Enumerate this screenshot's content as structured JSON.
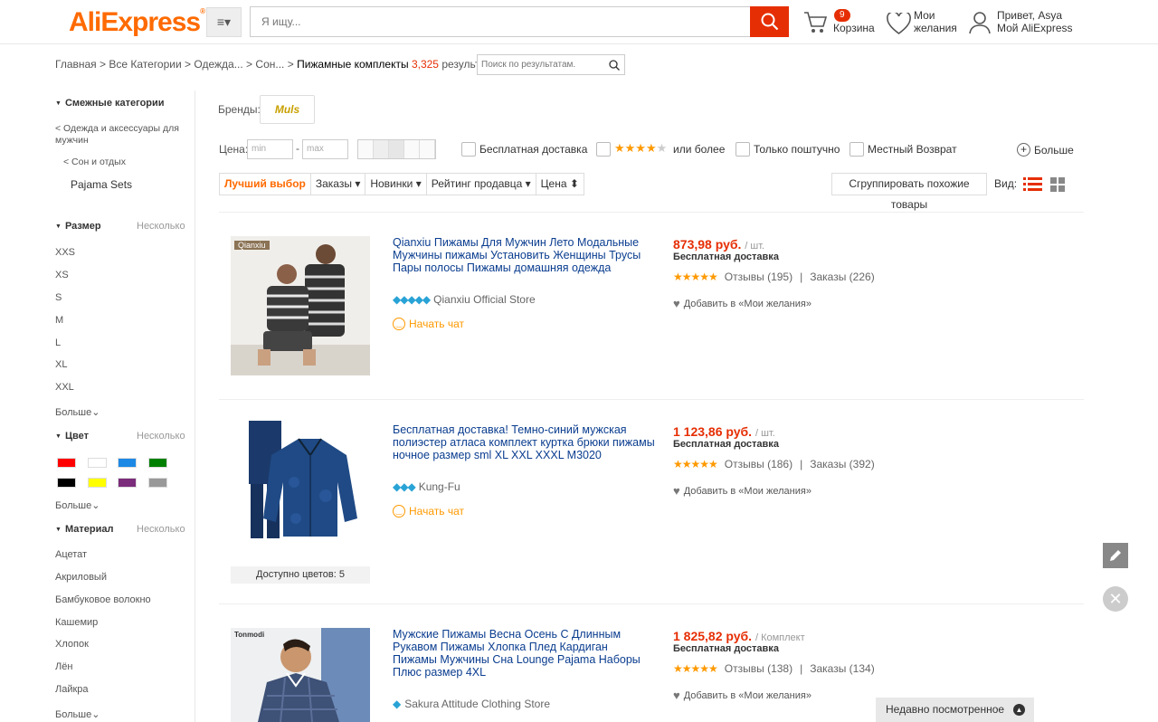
{
  "header": {
    "logo": "AliExpress",
    "search_placeholder": "Я ищу...",
    "cart_count": "9",
    "cart_label": "Корзина",
    "wishlist_line1": "Мои",
    "wishlist_line2": "желания",
    "greeting": "Привет, Asya",
    "my_account": "Мой AliExpress"
  },
  "breadcrumb": {
    "home": "Главная",
    "all": "Все Категории",
    "clothes": "Одежда...",
    "sleep": "Сон...",
    "current": "Пижамные комплекты",
    "count": "3,325",
    "results": "результатов",
    "search_placeholder": "Поиск по результатам."
  },
  "sidebar": {
    "related_title": "Смежные категории",
    "cat1": "< Одежда и аксессуары для мужчин",
    "cat2": "< Сон и отдых",
    "cat3": "Pajama Sets",
    "size_title": "Размер",
    "multi": "Несколько",
    "sizes": [
      "XXS",
      "XS",
      "S",
      "M",
      "L",
      "XL",
      "XXL"
    ],
    "more": "Больше",
    "color_title": "Цвет",
    "colors": [
      "#ff0000",
      "#ffffff",
      "#1e88e5",
      "#008000",
      "#000000",
      "#ffff00",
      "#7b2d7b",
      "#999999"
    ],
    "material_title": "Материал",
    "materials": [
      "Ацетат",
      "Акриловый",
      "Бамбуковое волокно",
      "Кашемир",
      "Хлопок",
      "Лён",
      "Лайкра"
    ]
  },
  "filters": {
    "brands_label": "Бренды:",
    "brand": "Muls",
    "price_label": "Цена:",
    "min": "min",
    "max": "max",
    "free_shipping": "Бесплатная доставка",
    "or_more": "или более",
    "per_piece": "Только поштучно",
    "local_return": "Местный Возврат",
    "more": "Больше"
  },
  "sort": {
    "best": "Лучший выбор",
    "orders": "Заказы",
    "new": "Новинки",
    "seller_rating": "Рейтинг продавца",
    "price": "Цена",
    "group": "Сгруппировать похожие товары",
    "view": "Вид:"
  },
  "products": [
    {
      "title": "Qianxiu Пижамы Для Мужчин Лето Модальные Мужчины пижамы Установить Женщины Трусы Пары полосы Пижамы домашняя одежда",
      "store": "Qianxiu Official Store",
      "chat": "Начать чат",
      "price": "873,98 руб.",
      "unit": "/ шт.",
      "free": "Бесплатная доставка",
      "reviews": "Отзывы (195)",
      "orders": "Заказы (226)",
      "wish": "Добавить в «Мои желания»",
      "img_label": "Qianxiu",
      "stars": 4.5,
      "diamonds": 5
    },
    {
      "title": "Бесплатная доставка! Темно-синий мужская полиэстер атласа комплект куртка брюки пижамы ночное размер sml XL XXL XXXL M3020",
      "store": "Kung-Fu",
      "chat": "Начать чат",
      "price": "1 123,86 руб.",
      "unit": "/ шт.",
      "free": "Бесплатная доставка",
      "reviews": "Отзывы (186)",
      "orders": "Заказы (392)",
      "wish": "Добавить в «Мои желания»",
      "colors_avail": "Доступно цветов: 5",
      "stars": 5,
      "diamonds": 3
    },
    {
      "title": "Мужские Пижамы Весна Осень С Длинным Рукавом Пижамы Хлопка Плед Кардиган Пижамы Мужчины Сна Lounge Pajama Наборы Плюс размер 4XL",
      "store": "Sakura Attitude Clothing Store",
      "price": "1 825,82 руб.",
      "unit": "/ Комплект",
      "free": "Бесплатная доставка",
      "reviews": "Отзывы (138)",
      "orders": "Заказы (134)",
      "wish": "Добавить в «Мои желания»",
      "img_label": "Tonmodi",
      "stars": 4.5,
      "diamonds": 1
    }
  ],
  "recent": "Недавно посмотренное",
  "colors": {
    "accent": "#ff6a00",
    "red": "#e62e04",
    "link": "#0a3d8f"
  }
}
